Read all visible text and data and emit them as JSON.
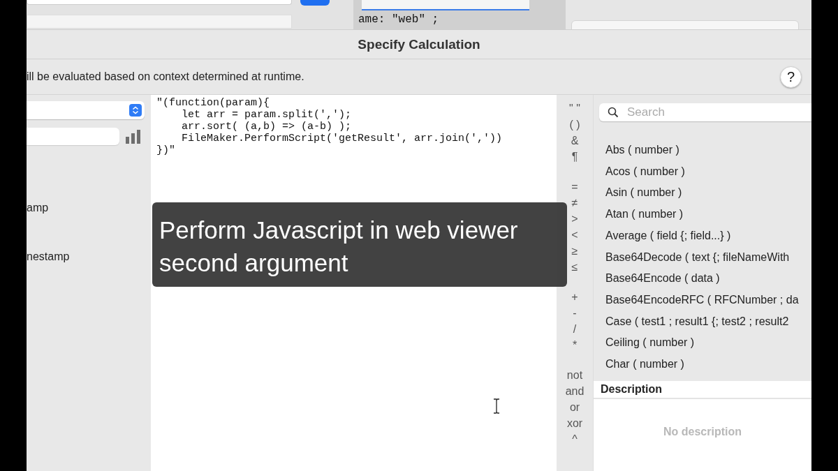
{
  "background": {
    "code_fragment": "ame: \"web\" ;"
  },
  "dialog": {
    "title": "Specify Calculation",
    "context_note": "ill be evaluated based on context determined at runtime.",
    "help_button": "?"
  },
  "left_panel": {
    "items": [
      {
        "label": "amp"
      },
      {
        "label": "nestamp"
      }
    ]
  },
  "formula": {
    "lines": [
      "\"(function(param){",
      "    let arr = param.split(',');",
      "    arr.sort( (a,b) => (a-b) );",
      "    FileMaker.PerformScript('getResult', arr.join(','))",
      "})\""
    ]
  },
  "caption": {
    "lines": [
      "Perform Javascript in web viewer",
      "second argument"
    ]
  },
  "operators": [
    [
      "\" \"",
      "( )",
      "&",
      "¶"
    ],
    [
      "=",
      "≠",
      ">",
      "<",
      "≥",
      "≤"
    ],
    [
      "+",
      "-",
      "/",
      "*"
    ],
    [
      "not",
      "and",
      "or",
      "xor",
      "^"
    ]
  ],
  "functions": {
    "search_placeholder": "Search",
    "items": [
      "Abs ( number )",
      "Acos ( number )",
      "Asin ( number )",
      "Atan ( number )",
      "Average ( field {; field...} )",
      "Base64Decode ( text {; fileNameWith",
      "Base64Encode ( data )",
      "Base64EncodeRFC ( RFCNumber ; da",
      "Case ( test1 ; result1 {; test2 ; result2",
      "Ceiling ( number )",
      "Char ( number )"
    ]
  },
  "description": {
    "heading": "Description",
    "text": "No description"
  }
}
